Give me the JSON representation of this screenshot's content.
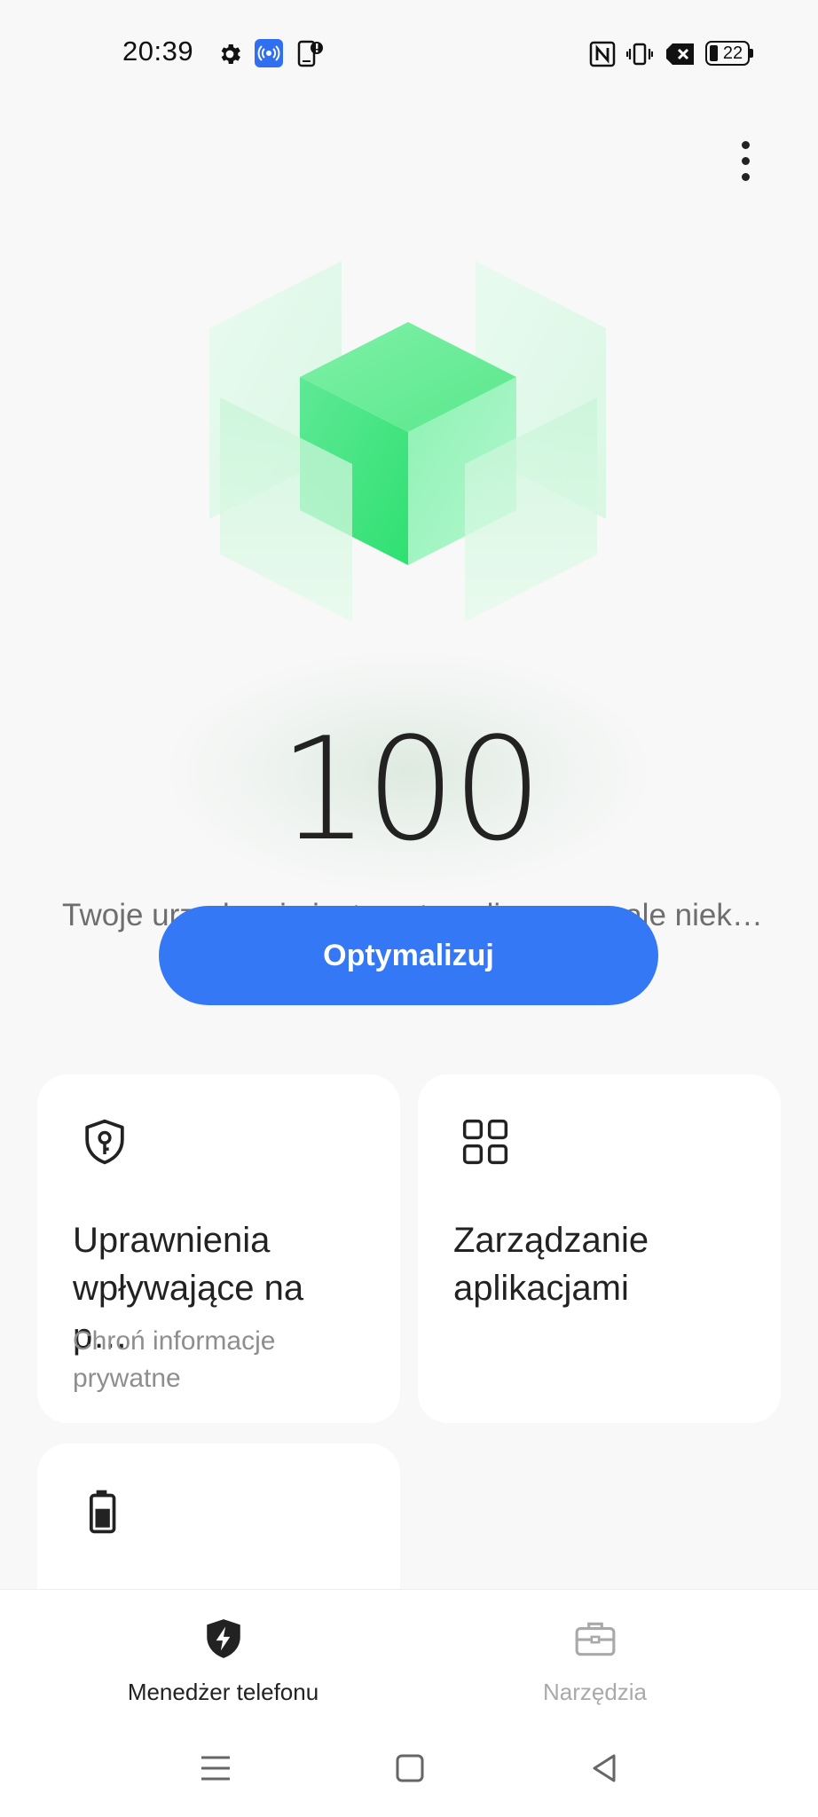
{
  "status_bar": {
    "time": "20:39",
    "left_icons": [
      "gear-icon",
      "hotspot-broadcast-icon",
      "phone-alert-icon"
    ],
    "right_icons": [
      "nfc-icon",
      "vibrate-icon",
      "no-sim-icon",
      "battery-icon"
    ],
    "battery_level": "22"
  },
  "header": {
    "more_icon": "more-vertical-icon"
  },
  "score": {
    "value": "100",
    "status_text": "Twoje urządzenie jest zoptymalizowane, ale niektóre elem…"
  },
  "optimize_button": {
    "label": "Optymalizuj",
    "color": "#3478f6"
  },
  "cards": [
    {
      "icon": "shield-key-icon",
      "title": "Uprawnienia wpływające na p…",
      "subtitle": "Chroń informacje prywatne"
    },
    {
      "icon": "apps-grid-icon",
      "title": "Zarządzanie aplikacjami",
      "subtitle": ""
    },
    {
      "icon": "battery-icon",
      "title": "",
      "subtitle": ""
    }
  ],
  "bottom_nav": [
    {
      "label": "Menedżer telefonu",
      "icon": "shield-bolt-icon",
      "active": true
    },
    {
      "label": "Narzędzia",
      "icon": "toolbox-icon",
      "active": false
    }
  ],
  "system_nav": [
    "menu-icon",
    "home-icon",
    "back-icon"
  ],
  "colors": {
    "accent": "#3478f6",
    "background": "#f8f8f8",
    "hero_green": "#3ee87a",
    "inactive_nav": "#a9a9a9"
  }
}
